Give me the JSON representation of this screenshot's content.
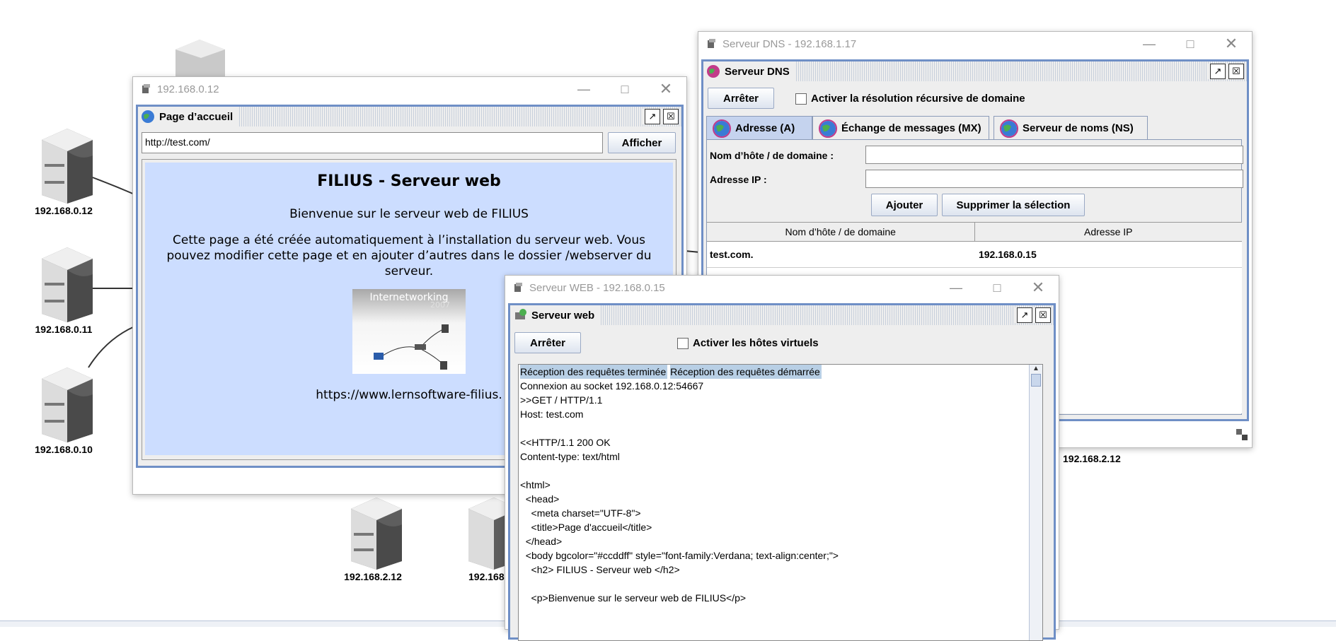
{
  "nodes": [
    {
      "label": "192.168.0.12"
    },
    {
      "label": "192.168.0.11"
    },
    {
      "label": "192.168.0.10"
    },
    {
      "label": "192.168.2.12"
    },
    {
      "label": "192.168"
    },
    {
      "label": "192.168.2.12"
    }
  ],
  "win_client": {
    "title": "192.168.0.12",
    "panel_title": "Page d’accueil",
    "url_value": "http://test.com/",
    "show_button": "Afficher",
    "page_heading": "FILIUS - Serveur web",
    "page_welcome": "Bienvenue sur le serveur web de FILIUS",
    "page_paragraph": "Cette page a été créée automatiquement à l’installation du serveur web. Vous pouvez modifier cette page et en ajouter d’autres dans le dossier /webserver du serveur.",
    "image_caption": "Internetworking",
    "image_year": "2007",
    "page_link": "https://www.lernsoftware-filius."
  },
  "win_dns": {
    "title": "Serveur DNS - 192.168.1.17",
    "panel_title": "Serveur DNS",
    "stop_button": "Arrêter",
    "recursive_label": "Activer la résolution récursive de domaine",
    "tabs": [
      {
        "label": "Adresse (A)"
      },
      {
        "label": "Échange de messages (MX)"
      },
      {
        "label": "Serveur de noms (NS)"
      }
    ],
    "host_label": "Nom d’hôte / de domaine :",
    "ip_label": "Adresse IP :",
    "add_button": "Ajouter",
    "delete_button": "Supprimer la sélection",
    "table_headers": [
      "Nom d’hôte / de domaine",
      "Adresse IP"
    ],
    "rows": [
      {
        "host": "test.com.",
        "ip": "192.168.0.15"
      }
    ]
  },
  "win_web": {
    "title": "Serveur WEB - 192.168.0.15",
    "panel_title": "Serveur web",
    "stop_button": "Arrêter",
    "vhosts_label": "Activer les hôtes virtuels",
    "log": [
      "Réception des requêtes terminée",
      "Réception des requêtes démarrée",
      "Connexion au socket 192.168.0.12:54667",
      ">>GET / HTTP/1.1",
      "Host: test.com",
      "",
      "<<HTTP/1.1 200 OK",
      "Content-type: text/html",
      "",
      "<html>",
      "  <head>",
      "    <meta charset=\"UTF-8\">",
      "    <title>Page d'accueil</title>",
      "  </head>",
      "  <body bgcolor=\"#ccddff\" style=\"font-family:Verdana; text-align:center;\">",
      "    <h2> FILIUS - Serveur web </h2>",
      "",
      "    <p>Bienvenue sur le serveur web de FILIUS</p>"
    ]
  }
}
